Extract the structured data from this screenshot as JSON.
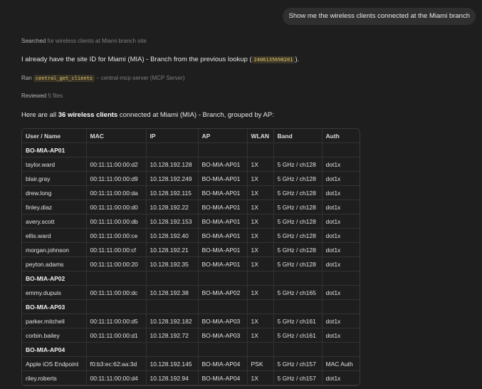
{
  "user_message": "Show me the wireless clients connected at the Miami branch",
  "steps": {
    "searched_label": "Searched",
    "searched_text": "for wireless clients at Miami branch site",
    "intro_before": "I already have the site ID for Miami (MIA) - Branch from the previous lookup (",
    "site_id": "2406135698201",
    "intro_after": ").",
    "ran_label": "Ran",
    "tool_name": "central_get_clients",
    "ran_suffix": "– central-mcp-server (MCP Server)",
    "reviewed_label": "Reviewed",
    "reviewed_text": "5 files"
  },
  "summary": {
    "prefix": "Here are all ",
    "count_text": "36 wireless clients",
    "suffix": " connected at Miami (MIA) - Branch, grouped by AP:"
  },
  "table": {
    "headers": [
      "User / Name",
      "MAC",
      "IP",
      "AP",
      "WLAN",
      "Band",
      "Auth"
    ],
    "groups": [
      {
        "ap": "BO-MIA-AP01",
        "rows": [
          [
            "taylor.ward",
            "00:11:11:00:00:d2",
            "10.128.192.128",
            "BO-MIA-AP01",
            "1X",
            "5 GHz / ch128",
            "dot1x"
          ],
          [
            "blair.gray",
            "00:11:11:00:00:d9",
            "10.128.192.249",
            "BO-MIA-AP01",
            "1X",
            "5 GHz / ch128",
            "dot1x"
          ],
          [
            "drew.long",
            "00:11:11:00:00:da",
            "10.128.192.115",
            "BO-MIA-AP01",
            "1X",
            "5 GHz / ch128",
            "dot1x"
          ],
          [
            "finley.diaz",
            "00:11:11:00:00:d0",
            "10.128.192.22",
            "BO-MIA-AP01",
            "1X",
            "5 GHz / ch128",
            "dot1x"
          ],
          [
            "avery.scott",
            "00:11:11:00:00:db",
            "10.128.192.153",
            "BO-MIA-AP01",
            "1X",
            "5 GHz / ch128",
            "dot1x"
          ],
          [
            "ellis.ward",
            "00:11:11:00:00:ce",
            "10.128.192.40",
            "BO-MIA-AP01",
            "1X",
            "5 GHz / ch128",
            "dot1x"
          ],
          [
            "morgan.johnson",
            "00:11:11:00:00:cf",
            "10.128.192.21",
            "BO-MIA-AP01",
            "1X",
            "5 GHz / ch128",
            "dot1x"
          ],
          [
            "peyton.adams",
            "00:11:11:00:00:20",
            "10.128.192.35",
            "BO-MIA-AP01",
            "1X",
            "5 GHz / ch128",
            "dot1x"
          ]
        ]
      },
      {
        "ap": "BO-MIA-AP02",
        "rows": [
          [
            "emmy.dupuis",
            "00:11:11:00:00:dc",
            "10.128.192.38",
            "BO-MIA-AP02",
            "1X",
            "5 GHz / ch165",
            "dot1x"
          ]
        ]
      },
      {
        "ap": "BO-MIA-AP03",
        "rows": [
          [
            "parker.mitchell",
            "00:11:11:00:00:d5",
            "10.128.192.182",
            "BO-MIA-AP03",
            "1X",
            "5 GHz / ch161",
            "dot1x"
          ],
          [
            "corbin.bailey",
            "00:11:11:00:00:d1",
            "10.128.192.72",
            "BO-MIA-AP03",
            "1X",
            "5 GHz / ch161",
            "dot1x"
          ]
        ]
      },
      {
        "ap": "BO-MIA-AP04",
        "rows": [
          [
            "Apple iOS Endpoint",
            "f0:b3:ec:62:aa:3d",
            "10.128.192.145",
            "BO-MIA-AP04",
            "PSK",
            "5 GHz / ch157",
            "MAC Auth"
          ],
          [
            "riley.roberts",
            "00:11:11:00:00:d4",
            "10.128.192.94",
            "BO-MIA-AP04",
            "1X",
            "5 GHz / ch157",
            "dot1x"
          ]
        ]
      }
    ]
  }
}
